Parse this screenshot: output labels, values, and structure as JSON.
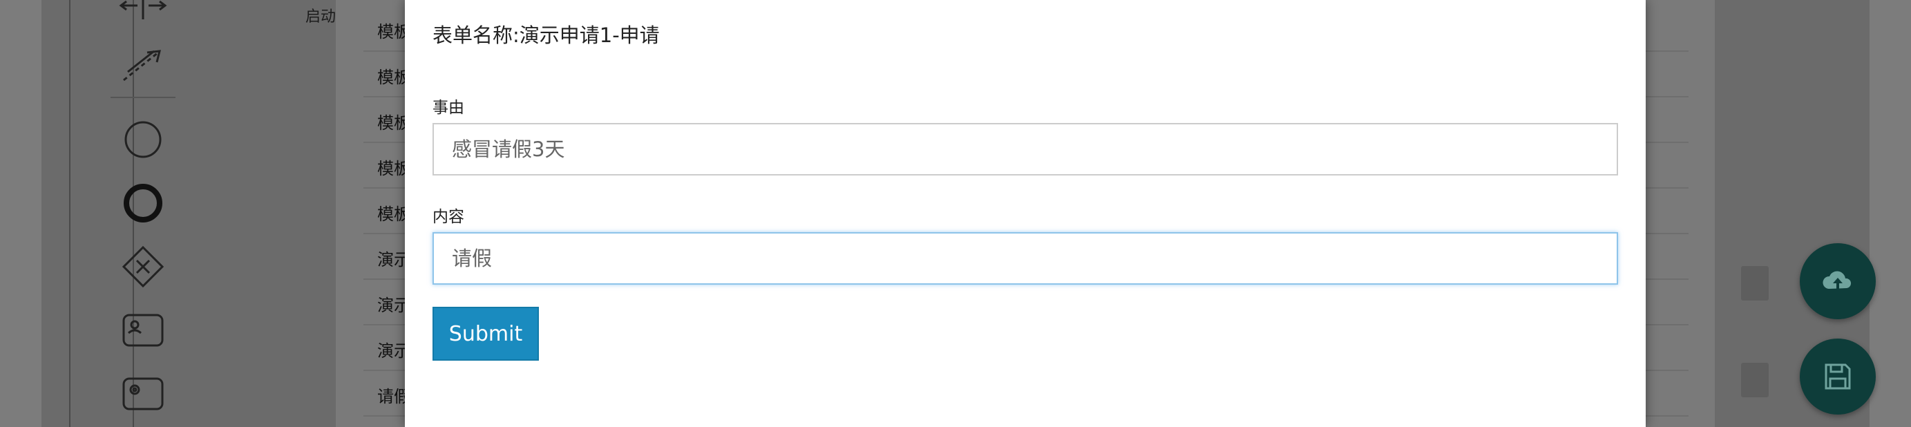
{
  "background": {
    "start_event_label": "启动",
    "template_list": [
      {
        "label": "模板"
      },
      {
        "label": "模板"
      },
      {
        "label": "模板"
      },
      {
        "label": "模板"
      },
      {
        "label": "模板"
      },
      {
        "label": "演示"
      },
      {
        "label": "演示"
      },
      {
        "label": "演示"
      },
      {
        "label": "请假"
      }
    ],
    "palette_icons": [
      "space-tool-icon",
      "connect-tool-icon",
      "start-event-icon",
      "end-event-icon",
      "gateway-icon",
      "user-task-icon",
      "service-task-icon"
    ],
    "fab_icons": [
      "cloud-upload-icon",
      "save-icon"
    ]
  },
  "form": {
    "title": "表单名称:演示申请1-申请",
    "fields": [
      {
        "label": "事由",
        "value": "感冒请假3天"
      },
      {
        "label": "内容",
        "value": "请假"
      }
    ],
    "submit_label": "Submit"
  },
  "colors": {
    "primary_button": "#1a8bbf",
    "focus_border": "#8ec4ea",
    "fab": "#0e3d3a"
  }
}
